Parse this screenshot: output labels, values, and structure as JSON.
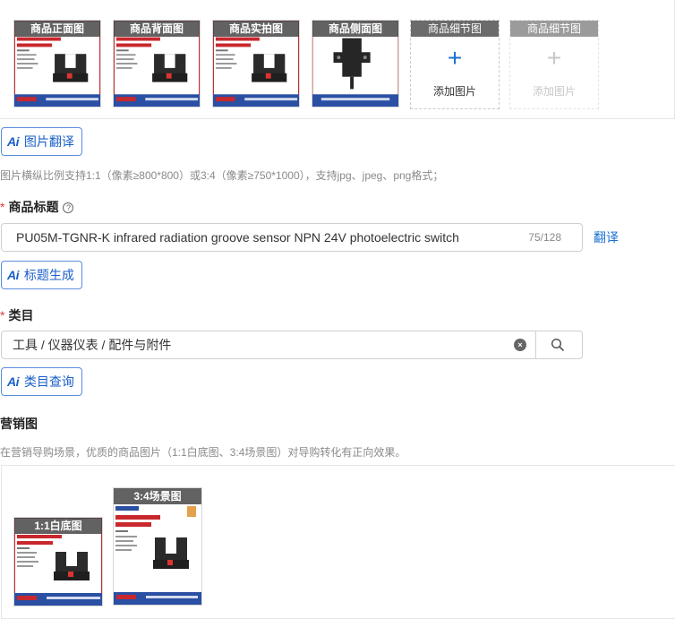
{
  "product_images": {
    "items": [
      {
        "tag": "商品正面图"
      },
      {
        "tag": "商品背面图"
      },
      {
        "tag": "商品实拍图"
      },
      {
        "tag": "商品侧面图"
      }
    ],
    "add_slots": [
      {
        "tag": "商品细节图",
        "label": "添加图片",
        "enabled": true
      },
      {
        "tag": "商品细节图",
        "label": "添加图片",
        "enabled": false
      }
    ],
    "card": {
      "headline": "槽型小光电传感器",
      "series": "PU05M 系列",
      "brand": "兰宝传感"
    }
  },
  "image_translate_button": {
    "ai": "Ai",
    "label": "图片翻译"
  },
  "image_hint": "图片横纵比例支持1:1（像素≥800*800）或3:4（像素≥750*1000），支持jpg、jpeg、png格式；",
  "title_field": {
    "required_mark": "*",
    "label": "商品标题",
    "help_icon": "?",
    "value": "PU05M-TGNR-K infrared radiation groove sensor NPN 24V photoelectric switch",
    "count": "75/128",
    "translate": "翻译"
  },
  "title_generate_button": {
    "ai": "Ai",
    "label": "标题生成"
  },
  "category_field": {
    "required_mark": "*",
    "label": "类目",
    "value": "工具 / 仪器仪表 / 配件与附件",
    "clear_icon": "×"
  },
  "category_query_button": {
    "ai": "Ai",
    "label": "类目查询"
  },
  "marketing": {
    "label": "营销图",
    "hint": "在营销导购场景，优质的商品图片（1:1白底图、3:4场景图）对导购转化有正向效果。",
    "items": [
      {
        "tag": "1:1白底图"
      },
      {
        "tag": "3:4场景图"
      }
    ]
  },
  "colors": {
    "accent": "#1a6fd1",
    "required": "#e4393c",
    "card_red": "#c8282d",
    "card_blue": "#2a4fa3"
  }
}
